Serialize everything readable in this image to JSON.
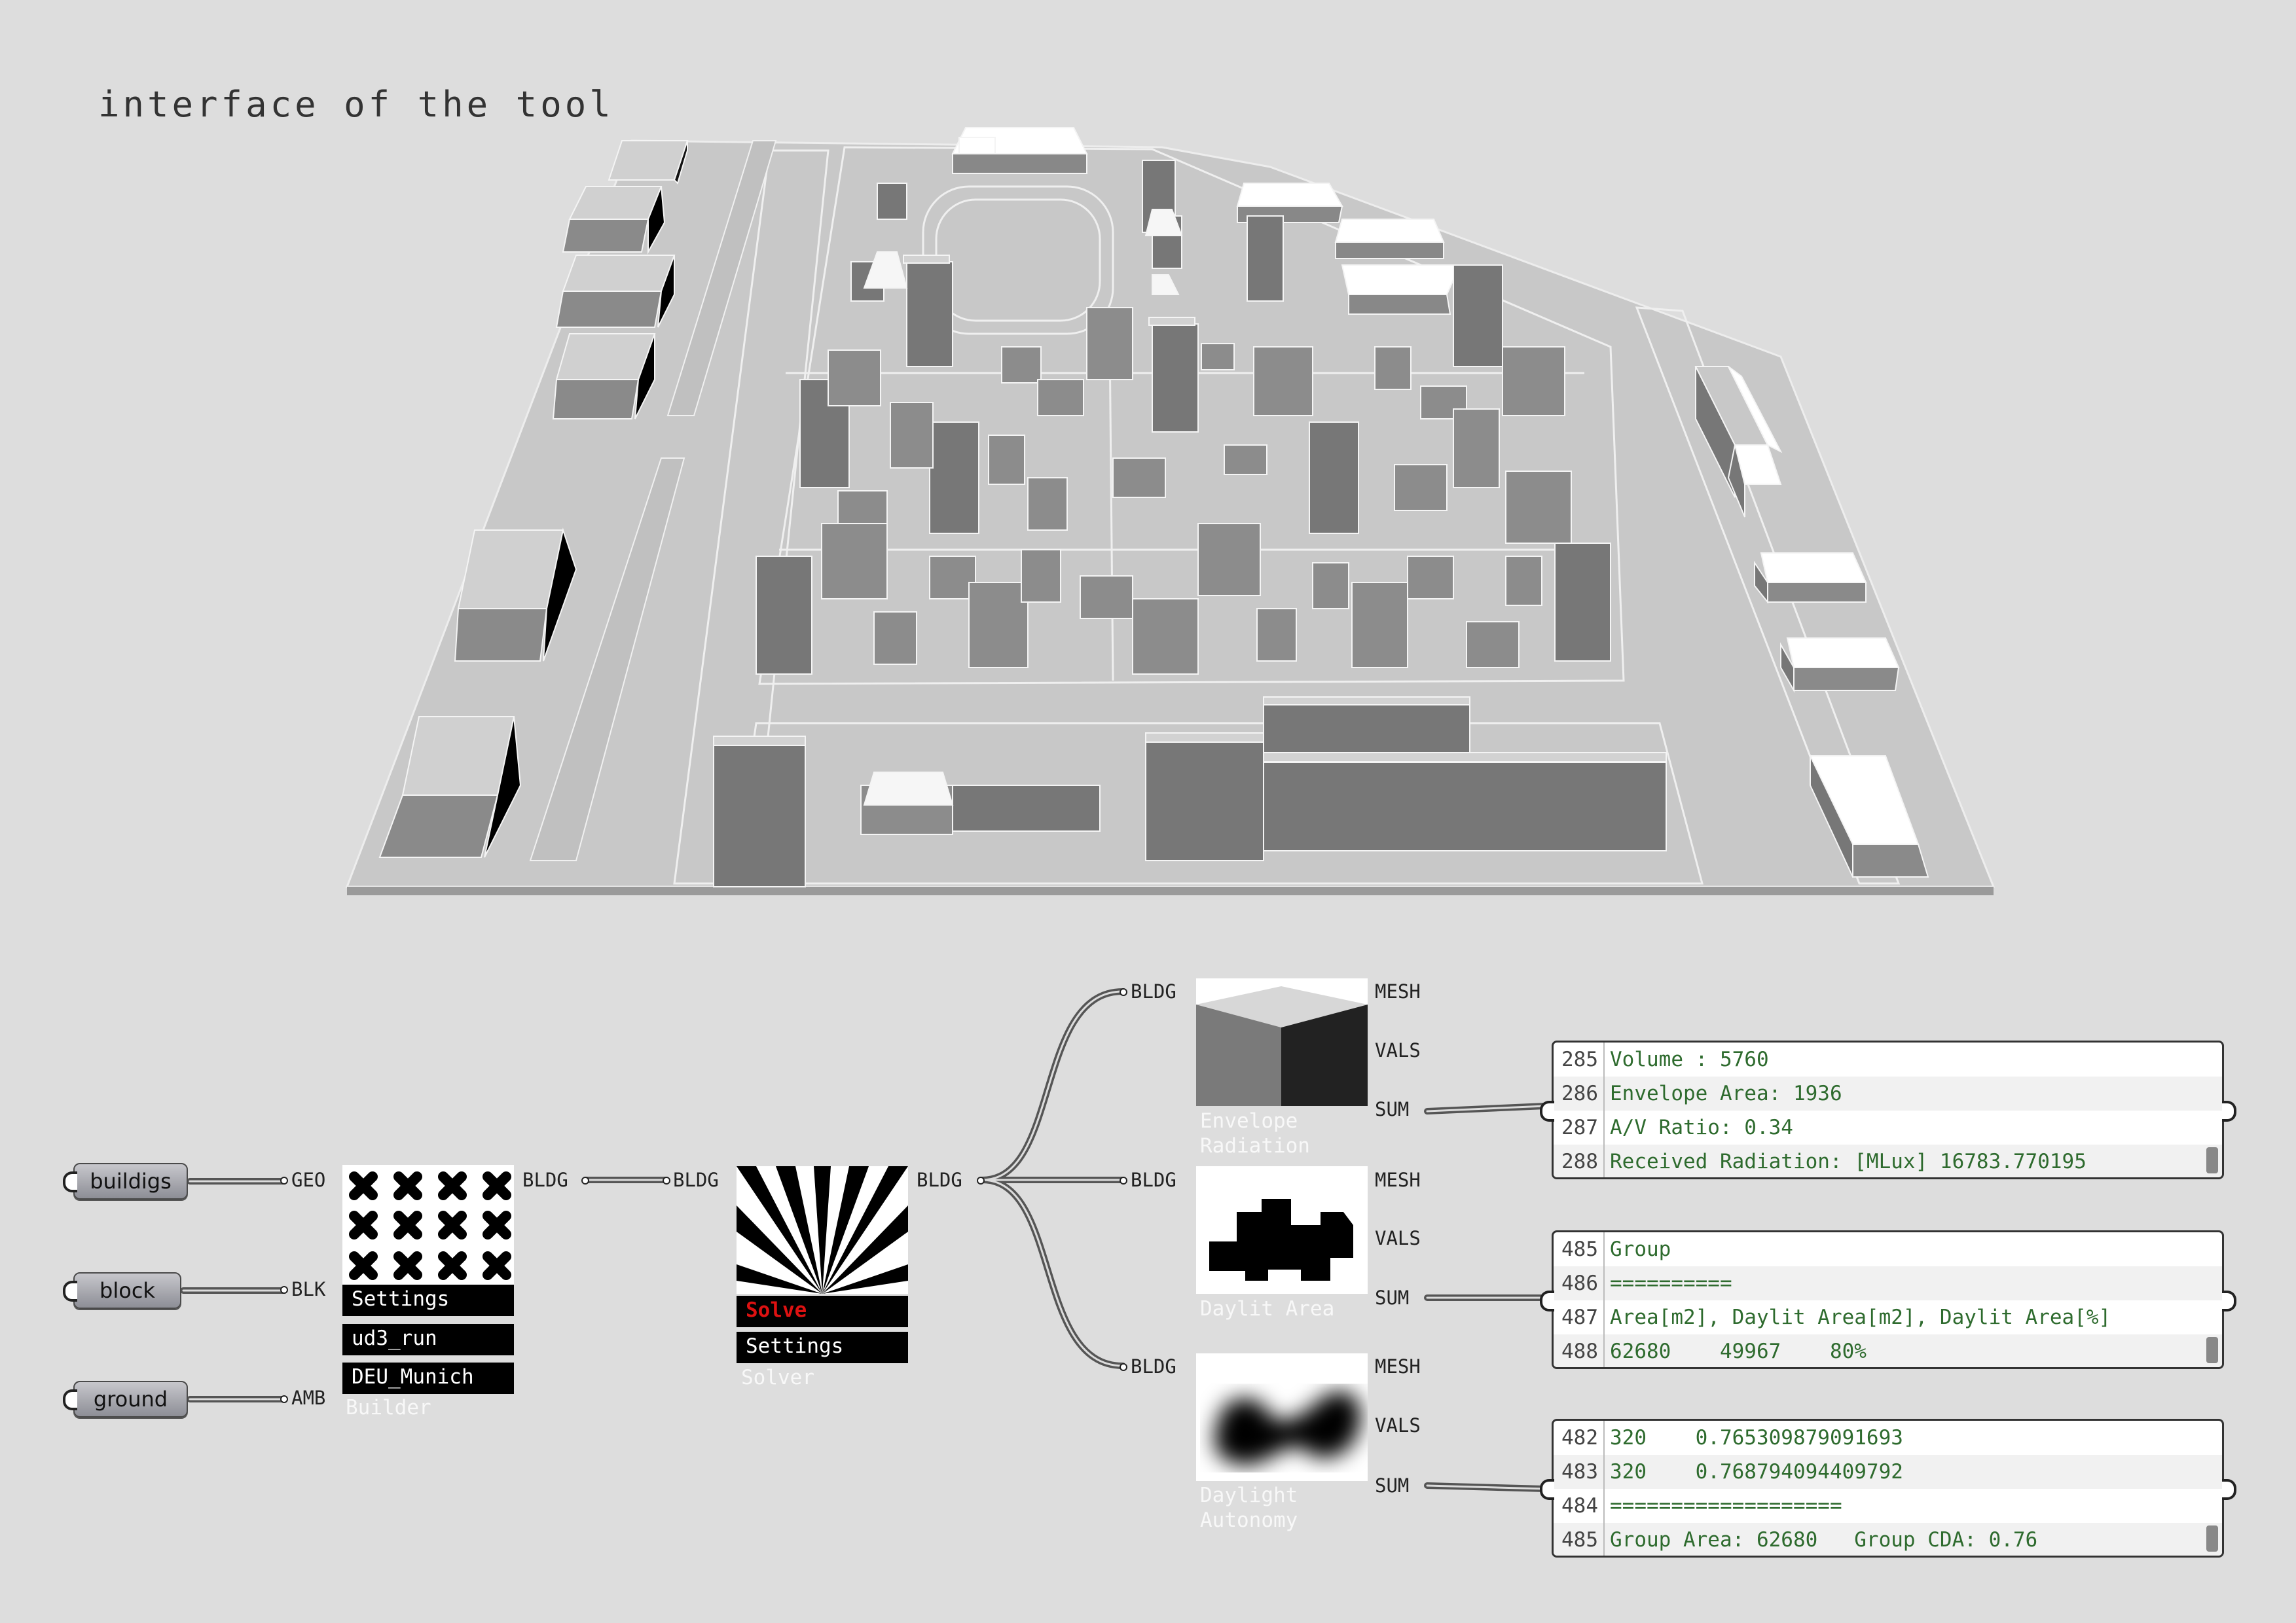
{
  "title": "interface of the tool",
  "inputs": [
    {
      "label": "buildigs",
      "pin": "GEO"
    },
    {
      "label": "block",
      "pin": "BLK"
    },
    {
      "label": "ground",
      "pin": "AMB"
    }
  ],
  "builder": {
    "name": "Builder",
    "buttons": [
      "Settings",
      "ud3_run",
      "DEU_Munich"
    ],
    "out_pin": "BLDG"
  },
  "solver": {
    "name": "Solver",
    "in_pin": "BLDG",
    "out_pin": "BLDG",
    "solve_label": "Solve",
    "settings_label": "Settings"
  },
  "analyses": [
    {
      "name_line1": "Envelope",
      "name_line2": "Radiation",
      "in_pin": "BLDG",
      "outputs": [
        "MESH",
        "VALS",
        "SUM"
      ]
    },
    {
      "name_line1": "Daylit Area",
      "name_line2": "",
      "in_pin": "BLDG",
      "outputs": [
        "MESH",
        "VALS",
        "SUM"
      ]
    },
    {
      "name_line1": "Daylight",
      "name_line2": "Autonomy",
      "in_pin": "BLDG",
      "outputs": [
        "MESH",
        "VALS",
        "SUM"
      ]
    }
  ],
  "panels": [
    {
      "rows": [
        {
          "n": "285",
          "t": "Volume : 5760"
        },
        {
          "n": "286",
          "t": "Envelope Area: 1936"
        },
        {
          "n": "287",
          "t": "A/V Ratio: 0.34"
        },
        {
          "n": "288",
          "t": "Received Radiation: [MLux] 16783.770195"
        }
      ]
    },
    {
      "rows": [
        {
          "n": "485",
          "t": "Group"
        },
        {
          "n": "486",
          "t": "=========="
        },
        {
          "n": "487",
          "t": "Area[m2], Daylit Area[m2], Daylit Area[%]"
        },
        {
          "n": "488",
          "t": "62680    49967    80%"
        }
      ]
    },
    {
      "rows": [
        {
          "n": "482",
          "t": "320    0.765309879091693"
        },
        {
          "n": "483",
          "t": "320    0.768794094409792"
        },
        {
          "n": "484",
          "t": "==================="
        },
        {
          "n": "485",
          "t": "Group Area: 62680   Group CDA: 0.76"
        }
      ]
    }
  ],
  "colors": {
    "background": "#dddddd",
    "model_top": "#d2d2d2",
    "model_side": "#7a7a7a",
    "panel_text": "#2e6b2e",
    "solve_red": "#dd1111"
  }
}
